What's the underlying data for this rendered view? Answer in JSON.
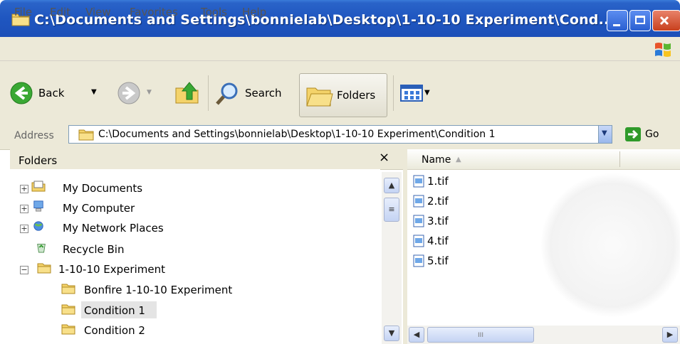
{
  "window": {
    "title": "C:\\Documents and Settings\\bonnielab\\Desktop\\1-10-10 Experiment\\Cond...",
    "controls": {
      "minimize": "_",
      "maximize": "□",
      "close": "X"
    }
  },
  "menu": [
    "File",
    "Edit",
    "View",
    "Favorites",
    "Tools",
    "Help"
  ],
  "toolbar": {
    "back_label": "Back",
    "search_label": "Search",
    "folders_label": "Folders"
  },
  "address": {
    "label": "Address",
    "value": "C:\\Documents and Settings\\bonnielab\\Desktop\\1-10-10 Experiment\\Condition 1",
    "go_label": "Go"
  },
  "folders_pane": {
    "title": "Folders",
    "close_glyph": "×",
    "items": [
      {
        "label": "My Documents",
        "expander": "+",
        "icon": "my-documents-icon"
      },
      {
        "label": "My Computer",
        "expander": "+",
        "icon": "my-computer-icon"
      },
      {
        "label": "My Network Places",
        "expander": "+",
        "icon": "network-places-icon"
      },
      {
        "label": "Recycle Bin",
        "expander": "",
        "icon": "recycle-bin-icon"
      },
      {
        "label": "1-10-10 Experiment",
        "expander": "−",
        "icon": "folder-icon"
      },
      {
        "label": "Bonfire 1-10-10 Experiment",
        "expander": "",
        "icon": "folder-icon"
      },
      {
        "label": "Condition 1",
        "expander": "",
        "icon": "folder-icon",
        "selected": true
      },
      {
        "label": "Condition 2",
        "expander": "",
        "icon": "folder-icon"
      }
    ]
  },
  "file_pane": {
    "column_name": "Name",
    "sort_glyph": "▲",
    "files": [
      "1.tif",
      "2.tif",
      "3.tif",
      "4.tif",
      "5.tif"
    ],
    "hscroll_thumb": "III"
  },
  "colors": {
    "titlebar": "#1f56c0",
    "chrome": "#ece9d8",
    "go_green": "#2f9a2a",
    "selection": "#e4e4e4"
  }
}
